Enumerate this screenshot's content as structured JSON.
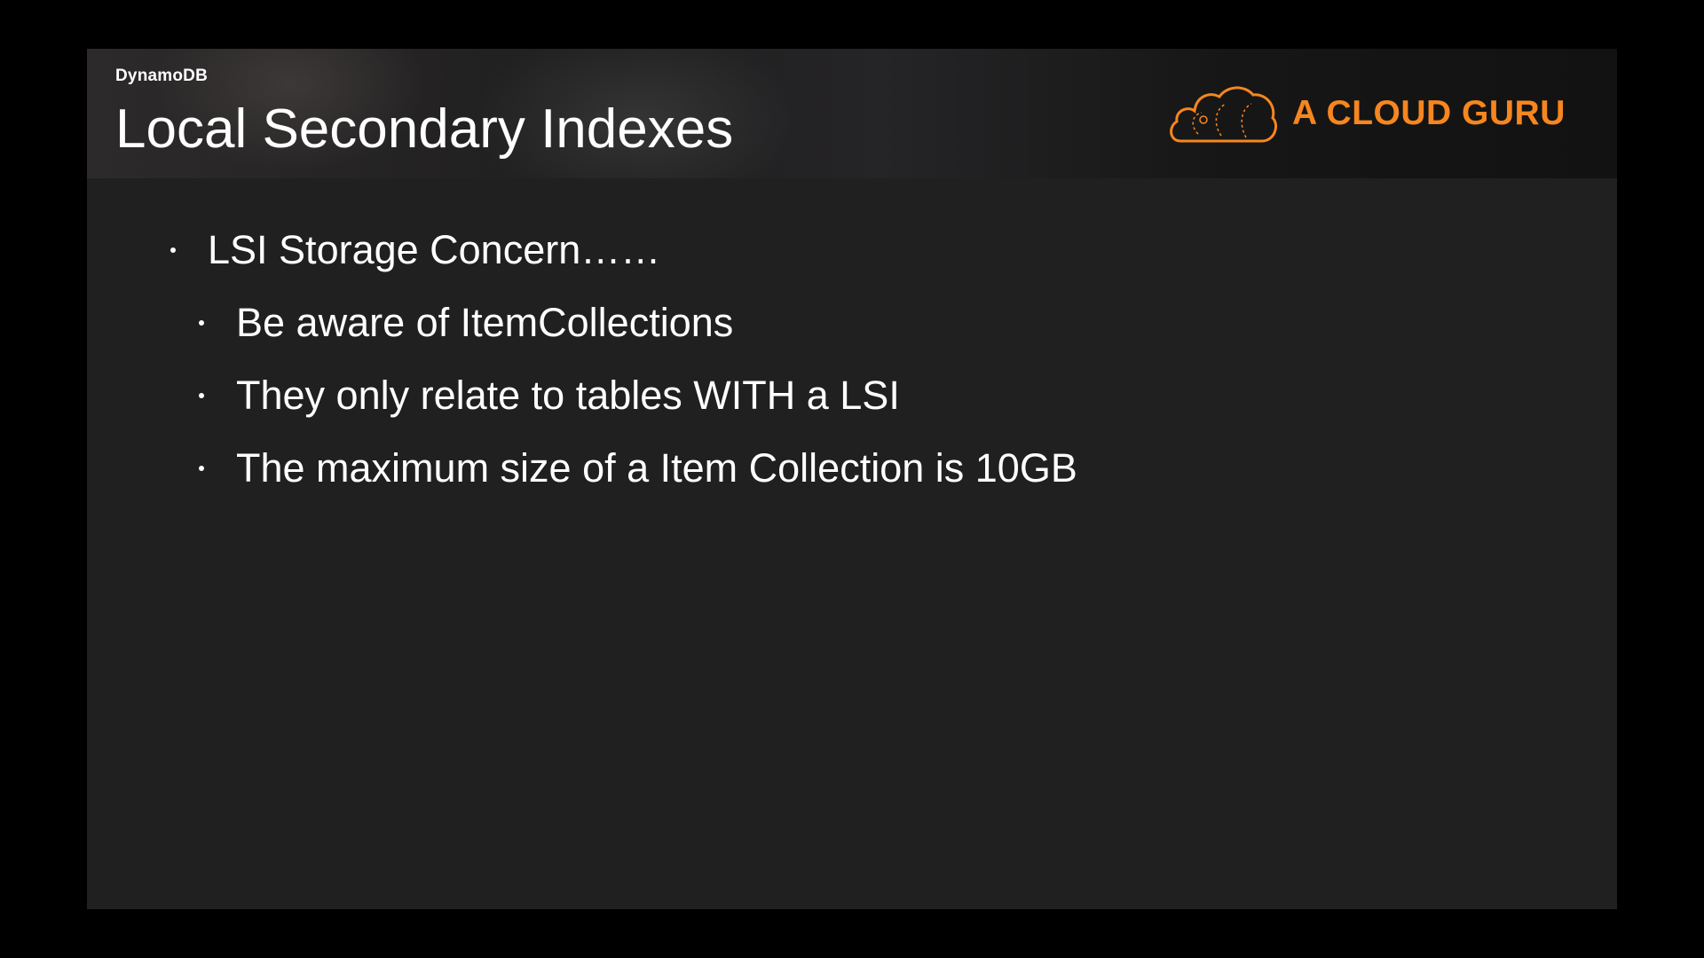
{
  "header": {
    "category": "DynamoDB",
    "title": "Local Secondary Indexes",
    "logo_text": "A CLOUD GURU",
    "logo_icon": "cloud-icon",
    "accent_color": "#f6861f"
  },
  "content": {
    "bullets": [
      {
        "level": 1,
        "text": "LSI Storage Concern……"
      },
      {
        "level": 2,
        "text": "Be aware of ItemCollections"
      },
      {
        "level": 2,
        "text": "They only relate to tables WITH a LSI"
      },
      {
        "level": 2,
        "text": "The maximum size of a Item Collection is 10GB"
      }
    ]
  }
}
